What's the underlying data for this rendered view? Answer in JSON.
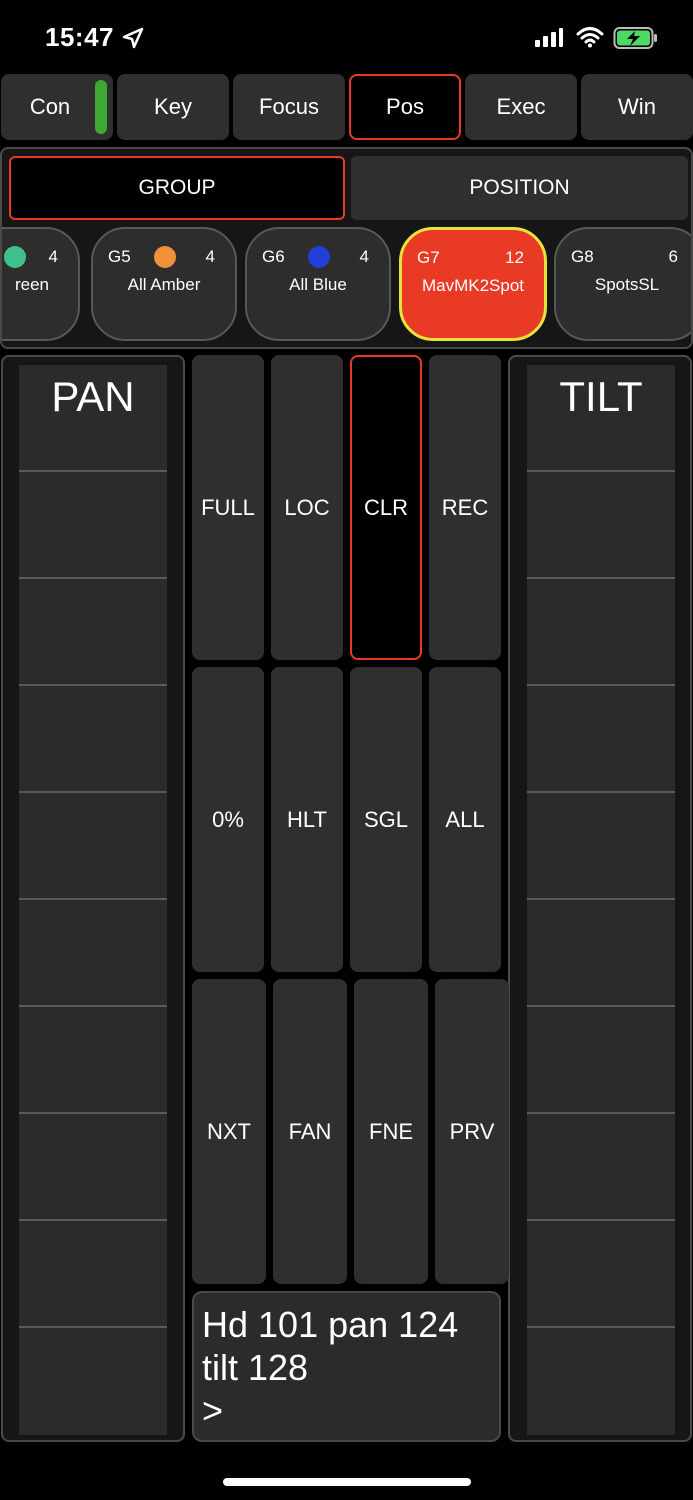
{
  "status": {
    "time": "15:47",
    "icons": [
      "location-arrow-icon",
      "cellular-signal-icon",
      "wifi-icon",
      "battery-charging-icon"
    ]
  },
  "tabs": [
    {
      "label": "Con"
    },
    {
      "label": "Key"
    },
    {
      "label": "Focus"
    },
    {
      "label": "Pos"
    },
    {
      "label": "Exec"
    },
    {
      "label": "Win"
    }
  ],
  "segments": {
    "group": "GROUP",
    "position": "POSITION"
  },
  "groups": [
    {
      "id": "",
      "name": "reen",
      "count": "4",
      "color": "#3fc08c"
    },
    {
      "id": "G5",
      "name": "All Amber",
      "count": "4",
      "color": "#f0903a"
    },
    {
      "id": "G6",
      "name": "All Blue",
      "count": "4",
      "color": "#1f3fd6"
    },
    {
      "id": "G7",
      "name": "MavMK2Spot",
      "count": "12",
      "color": ""
    },
    {
      "id": "G8",
      "name": "SpotsSL",
      "count": "6",
      "color": ""
    }
  ],
  "faders": {
    "pan": "PAN",
    "tilt": "TILT"
  },
  "keys": {
    "full": "FULL",
    "loc": "LOC",
    "clr": "CLR",
    "rec": "REC",
    "zero": "0%",
    "hlt": "HLT",
    "sgl": "SGL",
    "all": "ALL",
    "nxt": "NXT",
    "fan": "FAN",
    "fne": "FNE",
    "prv": "PRV"
  },
  "command_line": {
    "line1": "Hd 101 pan 124",
    "line2": "tilt 128",
    "line3": ">"
  },
  "colors": {
    "accent_red": "#e83a25",
    "select_yellow": "#e9e23a",
    "indicator_green": "#3fa832"
  }
}
